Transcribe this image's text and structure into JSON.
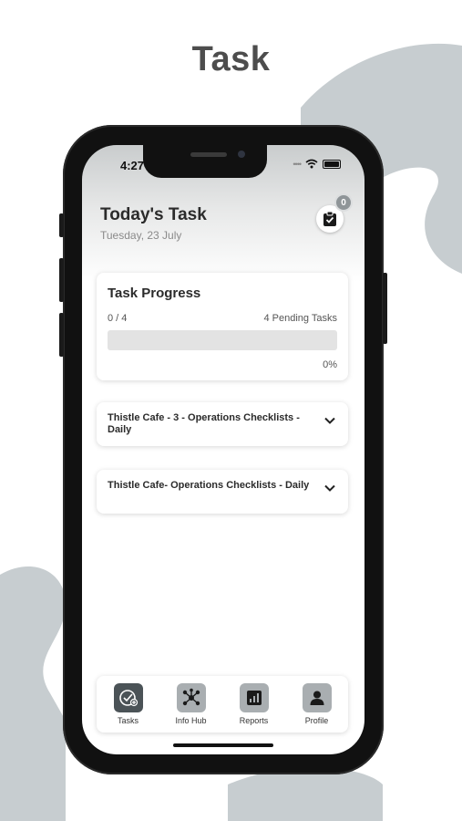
{
  "promo": {
    "title": "Task"
  },
  "status_bar": {
    "time": "4:27"
  },
  "header": {
    "title": "Today's Task",
    "date": "Tuesday, 23 July",
    "task_count_badge": "0"
  },
  "task_progress": {
    "title": "Task Progress",
    "count_label": "0 / 4",
    "pending_label": "4 Pending Tasks",
    "percent_label": "0%",
    "progress_fraction": 0
  },
  "checklists": [
    {
      "title": "Thistle Cafe - 3 - Operations Checklists - Daily"
    },
    {
      "title": "Thistle Cafe- Operations Checklists - Daily"
    }
  ],
  "bottom_nav": {
    "items": [
      {
        "label": "Tasks",
        "icon": "tasks-icon",
        "active": true
      },
      {
        "label": "Info Hub",
        "icon": "info-hub-icon",
        "active": false
      },
      {
        "label": "Reports",
        "icon": "reports-icon",
        "active": false
      },
      {
        "label": "Profile",
        "icon": "profile-icon",
        "active": false
      }
    ]
  },
  "colors": {
    "accent": "#4b5357",
    "nav_icon_inactive": "#a9aeb1",
    "blob": "#c7cdd0",
    "progress_track": "#e3e3e3"
  }
}
